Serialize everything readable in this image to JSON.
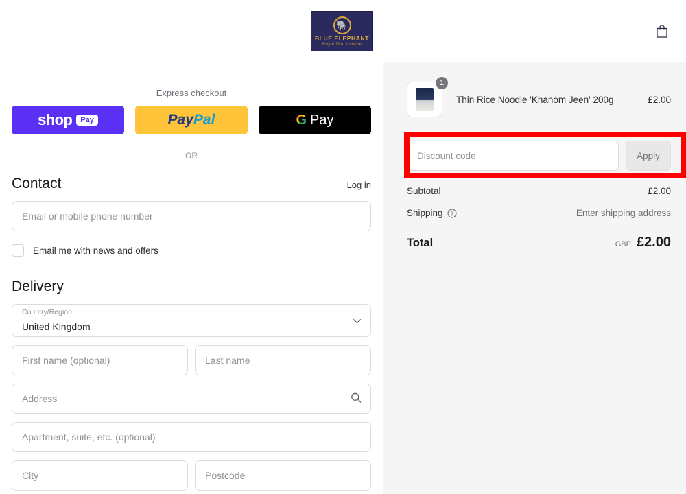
{
  "header": {
    "logo": {
      "emblem_icon": "elephant-icon",
      "brand_name": "BLUE ELEPHANT",
      "tagline": "Royal Thai Cuisine"
    },
    "cart_icon": "shopping-bag-icon"
  },
  "express": {
    "label": "Express checkout",
    "buttons": [
      {
        "name": "shop-pay",
        "text": "shop",
        "badge": "Pay",
        "color": "#5a31f4"
      },
      {
        "name": "paypal",
        "text_a": "Pay",
        "text_b": "Pal",
        "color": "#ffc439"
      },
      {
        "name": "google-pay",
        "letter": "G",
        "text": "Pay",
        "color": "#000000"
      }
    ],
    "divider_text": "OR"
  },
  "contact": {
    "title": "Contact",
    "login_label": "Log in",
    "email_placeholder": "Email or mobile phone number",
    "email_value": "",
    "newsletter_label": "Email me with news and offers",
    "newsletter_checked": false
  },
  "delivery": {
    "title": "Delivery",
    "country": {
      "label": "Country/Region",
      "value": "United Kingdom",
      "icon": "chevron-down-icon"
    },
    "first_name_placeholder": "First name (optional)",
    "first_name_value": "",
    "last_name_placeholder": "Last name",
    "last_name_value": "",
    "address_placeholder": "Address",
    "address_value": "",
    "address_icon": "search-icon",
    "apartment_placeholder": "Apartment, suite, etc. (optional)",
    "apartment_value": "",
    "city_placeholder": "City",
    "city_value": "",
    "postcode_placeholder": "Postcode",
    "postcode_value": ""
  },
  "summary": {
    "item": {
      "name": "Thin Rice Noodle 'Khanom Jeen' 200g",
      "price": "£2.00",
      "quantity": "1",
      "thumbnail": "noodle-package-image"
    },
    "discount": {
      "placeholder": "Discount code",
      "value": "",
      "apply_label": "Apply",
      "highlight_color": "#ff0000"
    },
    "subtotal_label": "Subtotal",
    "subtotal_value": "£2.00",
    "shipping_label": "Shipping",
    "shipping_info_icon": "question-mark-circle-icon",
    "shipping_value": "Enter shipping address",
    "total_label": "Total",
    "total_currency": "GBP",
    "total_value": "£2.00"
  }
}
